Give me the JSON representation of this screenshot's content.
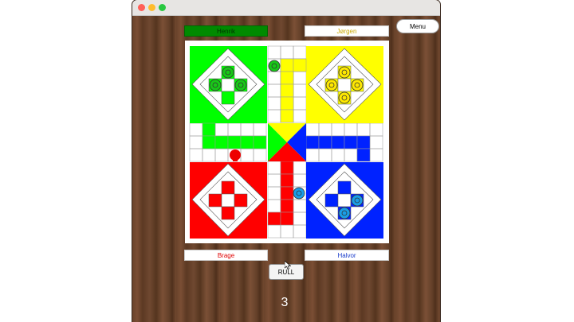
{
  "window": {
    "controls": [
      "close-icon",
      "minimize-icon",
      "zoom-icon"
    ],
    "control_colors": [
      "#ff5f57",
      "#febc2e",
      "#28c840"
    ]
  },
  "players": {
    "top_left": {
      "name": "Henrik",
      "color": "#00d300",
      "bar_bg": "#008a00",
      "text_color": "#003300"
    },
    "top_right": {
      "name": "Jørgen",
      "color": "#f2d200",
      "bar_bg": "#ffffff",
      "text_color": "#c9a800"
    },
    "bottom_left": {
      "name": "Brage",
      "color": "#ff0000",
      "bar_bg": "#ffffff",
      "text_color": "#e00000"
    },
    "bottom_right": {
      "name": "Halvor",
      "color": "#0044ee",
      "bar_bg": "#ffffff",
      "text_color": "#1a3dcc"
    }
  },
  "menu_label": "Menu",
  "roll_label": "RULL",
  "dice_value": "3",
  "colors": {
    "green": "#00ff00",
    "yellow": "#ffff00",
    "red": "#ff0000",
    "blue": "#0022ff",
    "piece_green": "#18c818",
    "piece_yellow": "#ffe800",
    "piece_red": "#ee0000",
    "piece_blue": "#1a9ee8"
  }
}
